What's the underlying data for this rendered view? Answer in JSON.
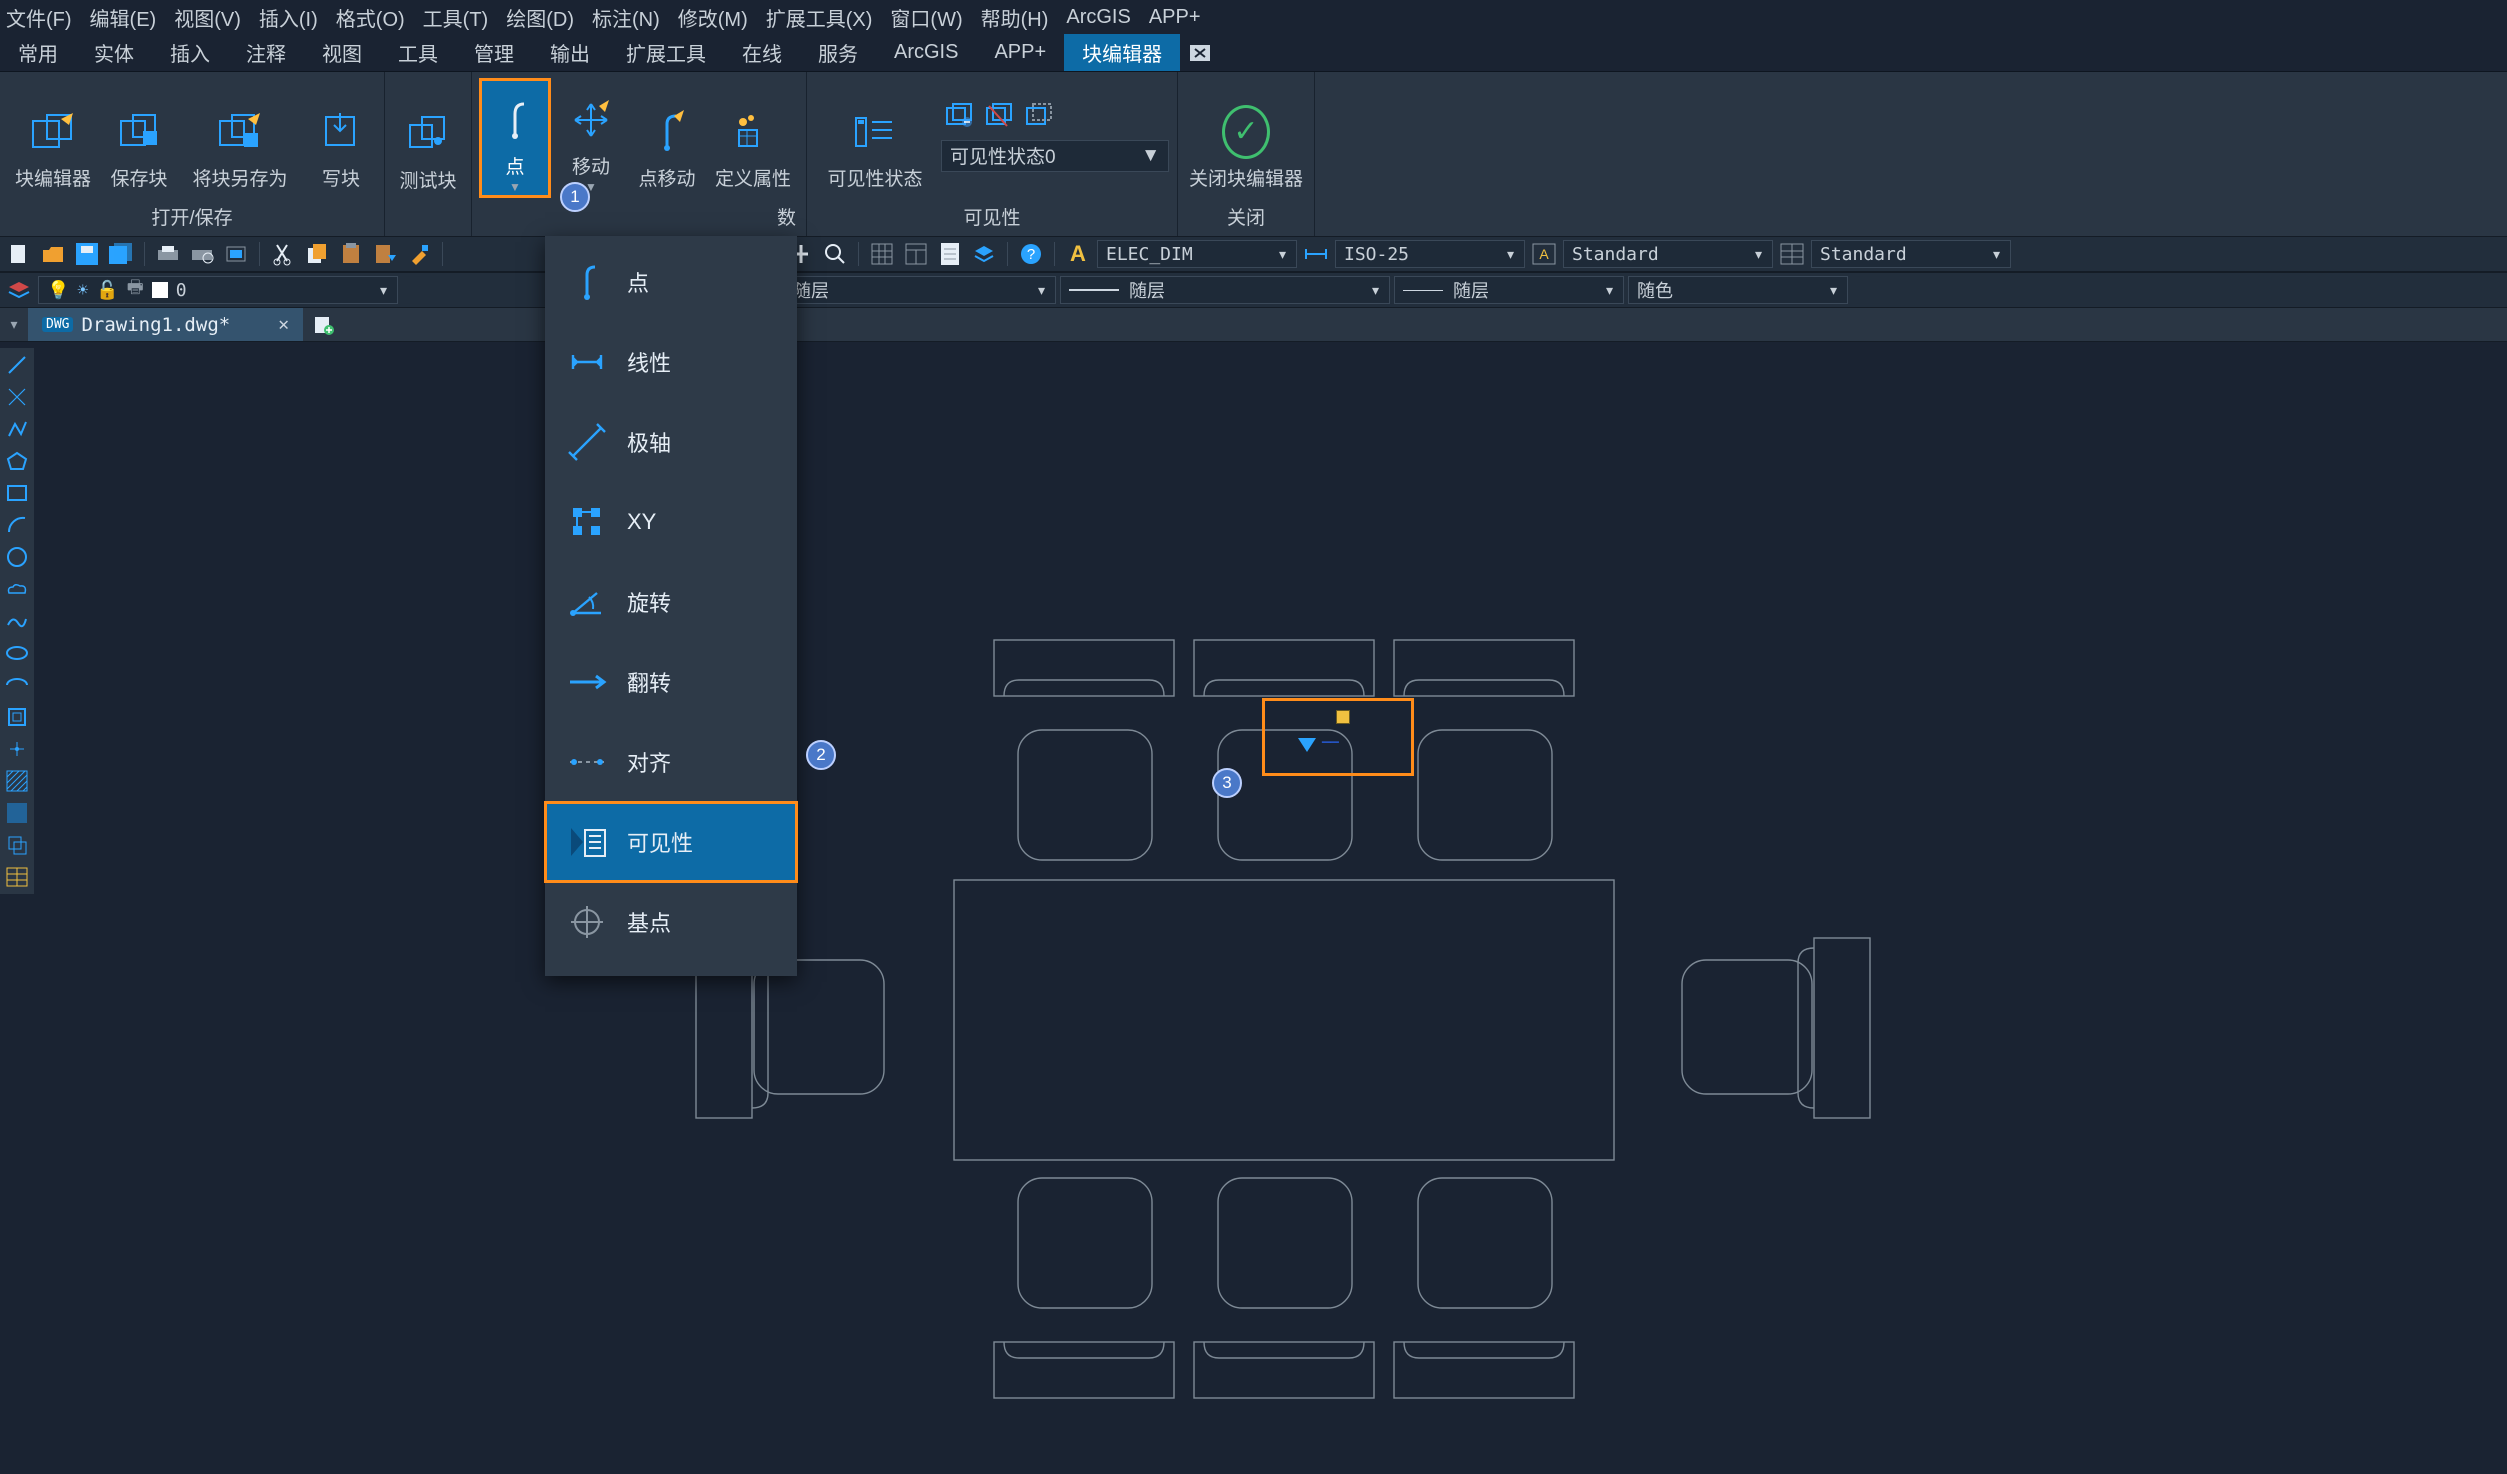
{
  "menus": [
    "文件(F)",
    "编辑(E)",
    "视图(V)",
    "插入(I)",
    "格式(O)",
    "工具(T)",
    "绘图(D)",
    "标注(N)",
    "修改(M)",
    "扩展工具(X)",
    "窗口(W)",
    "帮助(H)",
    "ArcGIS",
    "APP+"
  ],
  "tabs": [
    "常用",
    "实体",
    "插入",
    "注释",
    "视图",
    "工具",
    "管理",
    "输出",
    "扩展工具",
    "在线",
    "服务",
    "ArcGIS",
    "APP+",
    "块编辑器"
  ],
  "active_tab": "块编辑器",
  "ribbon": {
    "open_save": {
      "title": "打开/保存",
      "btns": [
        "块编辑器",
        "保存块",
        "将块另存为",
        "写块"
      ]
    },
    "test": {
      "btn": "测试块"
    },
    "param": {
      "btns": [
        "点",
        "移动",
        "点移动",
        "定义属性"
      ],
      "active": "点"
    },
    "visibility": {
      "title": "可见性",
      "btn": "可见性状态",
      "dropdown": "可见性状态0"
    },
    "close": {
      "title": "关闭",
      "btn": "关闭块编辑器"
    }
  },
  "dd_items": [
    "点",
    "线性",
    "极轴",
    "XY",
    "旋转",
    "翻转",
    "对齐",
    "可见性",
    "基点"
  ],
  "dd_selected": "可见性",
  "param_panel_rest_title": "数",
  "layer_row": {
    "layer_name": "0"
  },
  "prop_row": {
    "dim_style": "ELEC_DIM",
    "iso": "ISO-25",
    "text_style": "Standard",
    "table_style": "Standard",
    "linetype": "随层",
    "linetype2": "随层",
    "lineweight": "随层",
    "color": "随色"
  },
  "doc_tab": {
    "name": "Drawing1.dwg*",
    "badge": "DWG"
  },
  "callouts": {
    "1": "1",
    "2": "2",
    "3": "3"
  }
}
